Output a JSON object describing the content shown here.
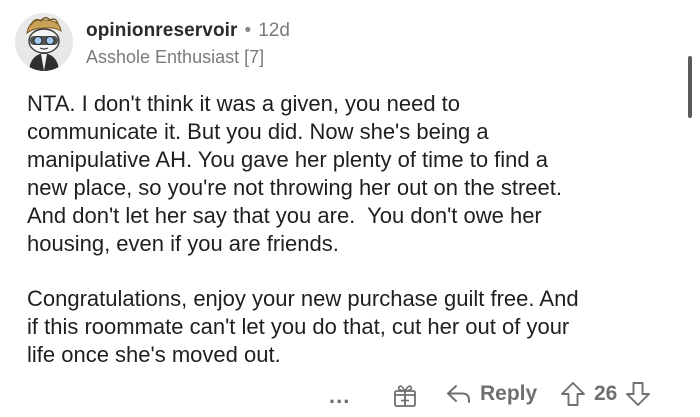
{
  "comment": {
    "username": "opinionreservoir",
    "separator": "•",
    "age": "12d",
    "flair": "Asshole Enthusiast [7]",
    "paragraphs": [
      "NTA. I don't think it was a given, you need to\ncommunicate it. But you did. Now she's being a\nmanipulative AH. You gave her plenty of time to find a\nnew place, so you're not throwing her out on the street.\nAnd don't let her say that you are.  You don't owe her\nhousing, even if you are friends.",
      "Congratulations, enjoy your new purchase guilt free. And\nif this roommate can't let you do that, cut her out of your\nlife once she's moved out."
    ]
  },
  "actions": {
    "more_label": "...",
    "reply_label": "Reply",
    "score": "26"
  },
  "icons": {
    "avatar": "snoo-avatar-icon",
    "more": "more-options-icon",
    "award": "award-gift-icon",
    "reply": "reply-arrow-icon",
    "upvote": "upvote-arrow-icon",
    "downvote": "downvote-arrow-icon"
  },
  "colors": {
    "text": "#1f1f1f",
    "muted": "#7a7a7a",
    "icon": "#707070"
  }
}
